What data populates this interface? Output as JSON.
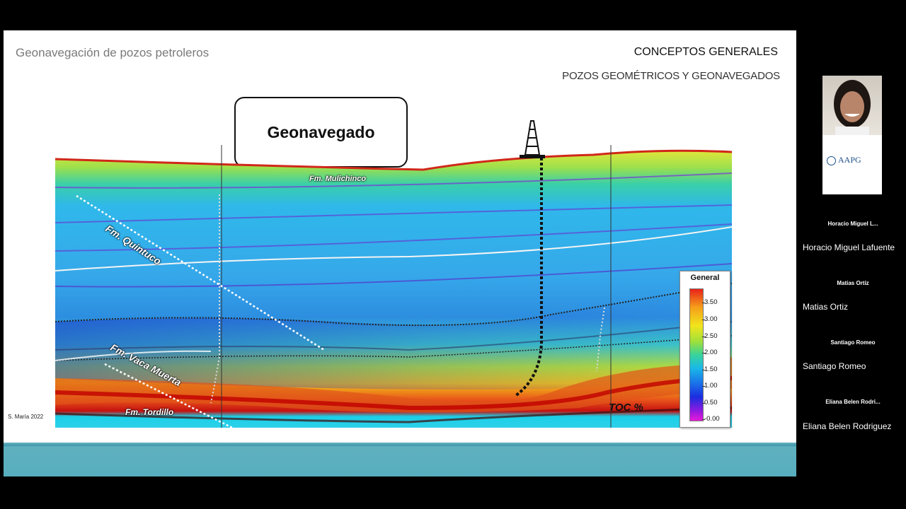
{
  "slide": {
    "title": "Geonavegación de pozos petroleros",
    "heading": "CONCEPTOS GENERALES",
    "subheading": "POZOS GEOMÉTRICOS Y GEONAVEGADOS",
    "box_label": "Geonavegado",
    "credit": "S. María 2022",
    "formations": {
      "mulichinco": "Fm. Mulichinco",
      "quintuco": "Fm. Quintuco",
      "vaca_muerta": "Fm. Vaca Muerta",
      "tordillo": "Fm. Tordillo"
    },
    "toc_label": "TOC %",
    "legend": {
      "title": "General",
      "ticks": [
        "3.50",
        "3.00",
        "2.50",
        "2.00",
        "1.50",
        "1.00",
        "0.50",
        "-0.00"
      ],
      "tick_values": [
        3.5,
        3.0,
        2.5,
        2.0,
        1.5,
        1.0,
        0.5,
        0.0
      ],
      "colors": [
        "#e8231a",
        "#f5a01a",
        "#f1e51c",
        "#9ee03a",
        "#38d39a",
        "#1ab9e8",
        "#1a6fe8",
        "#1a2ee0",
        "#8a1ae0",
        "#e81ad8"
      ]
    },
    "footer_color": "#58aebe"
  },
  "participants": {
    "logo_text": "AAPG",
    "people": [
      {
        "short": "Horacio Miguel L...",
        "full": "Horacio Miguel Lafuente"
      },
      {
        "short": "Matias  Ortiz",
        "full": "Matias  Ortiz"
      },
      {
        "short": "Santiago Romeo",
        "full": "Santiago Romeo"
      },
      {
        "short": "Eliana Belen Rodri...",
        "full": "Eliana Belen Rodriguez"
      }
    ]
  }
}
